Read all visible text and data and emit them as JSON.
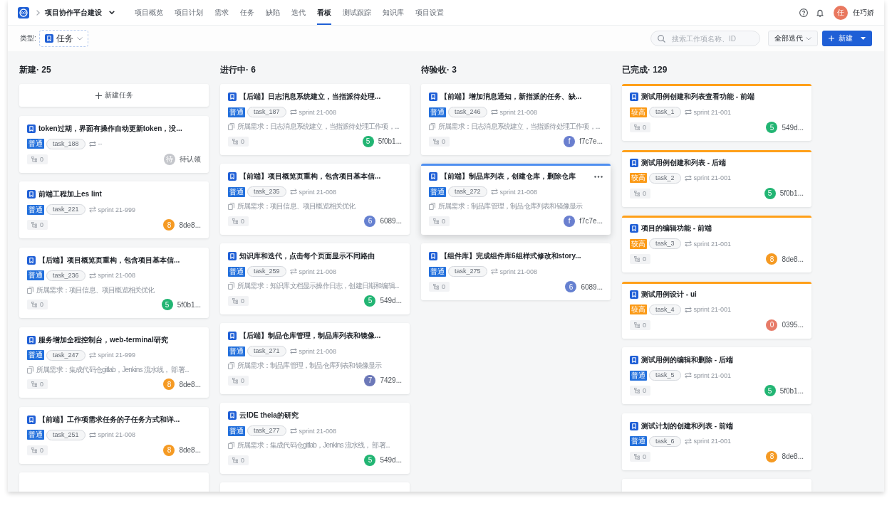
{
  "nav": {
    "project": "项目协作平台建设",
    "tabs": [
      {
        "label": "项目概览",
        "selected": false
      },
      {
        "label": "项目计划",
        "selected": false
      },
      {
        "label": "需求",
        "selected": false
      },
      {
        "label": "任务",
        "selected": false
      },
      {
        "label": "缺陷",
        "selected": false
      },
      {
        "label": "迭代",
        "selected": false
      },
      {
        "label": "看板",
        "selected": true
      },
      {
        "label": "测试跟踪",
        "selected": false
      },
      {
        "label": "知识库",
        "selected": false
      },
      {
        "label": "项目设置",
        "selected": false
      }
    ],
    "user": {
      "avatar": "任",
      "name": "任巧娇"
    }
  },
  "toolbar": {
    "type_label": "类型:",
    "type_select": "任务",
    "search": {
      "placeholder": "搜索工作项名称、ID"
    },
    "iteration_select": "全部迭代",
    "new_button": "新建"
  },
  "board": {
    "columns": [
      {
        "title": "新建· 25",
        "add_button": "新建任务",
        "more": true,
        "cards": [
          {
            "kind": "normal",
            "title": "token过期，界面有操作自动更新token，没...",
            "priority_label": "普通",
            "task_id": "task_188",
            "sprint": "--",
            "subtasks": "0",
            "assignee": {
              "avatar": "待",
              "name": "待认领",
              "color": "#c5c7cc"
            },
            "hovered": false
          },
          {
            "kind": "normal",
            "title": "前端工程加上es lint",
            "priority_label": "普通",
            "task_id": "task_221",
            "sprint": "sprint 21-999",
            "subtasks": "0",
            "assignee": {
              "avatar": "8",
              "name": "8de8...",
              "color": "#f59a23"
            },
            "hovered": false
          },
          {
            "kind": "normal",
            "title": "【后端】项目概览页重构，包含项目基本信...",
            "priority_label": "普通",
            "task_id": "task_236",
            "sprint": "sprint 21-008",
            "requirement": "所属需求：项目信息、项目概览相关优化",
            "subtasks": "0",
            "assignee": {
              "avatar": "5",
              "name": "5f0b1...",
              "color": "#22b573"
            },
            "hovered": false
          },
          {
            "kind": "normal",
            "title": "服务增加全程控制台，web-terminal研究",
            "priority_label": "普通",
            "task_id": "task_247",
            "sprint": "sprint 21-999",
            "requirement": "所属需求：集成代码仓gitlab，Jenkins 流水线， 部署...",
            "subtasks": "0",
            "assignee": {
              "avatar": "8",
              "name": "8de8...",
              "color": "#f59a23"
            },
            "hovered": false
          },
          {
            "kind": "normal",
            "title": "【前端】工作项需求任务的子任务方式和详...",
            "priority_label": "普通",
            "task_id": "task_251",
            "sprint": "sprint 21-008",
            "subtasks": "0",
            "assignee": {
              "avatar": "8",
              "name": "8de8...",
              "color": "#f59a23"
            },
            "hovered": false
          }
        ]
      },
      {
        "title": "进行中· 6",
        "more": true,
        "cards": [
          {
            "kind": "normal",
            "title": "【后端】日志消息系统建立，当指派待处理...",
            "priority_label": "普通",
            "task_id": "task_187",
            "sprint": "sprint 21-008",
            "requirement": "所属需求：日志消息系统建立，当指派待处理工作项，...",
            "subtasks": "0",
            "assignee": {
              "avatar": "5",
              "name": "5f0b1...",
              "color": "#22b573"
            },
            "hovered": false
          },
          {
            "kind": "normal",
            "title": "【前端】项目概览页重构，包含项目基本信...",
            "priority_label": "普通",
            "task_id": "task_235",
            "sprint": "sprint 21-008",
            "requirement": "所属需求：项目信息、项目概览相关优化",
            "subtasks": "0",
            "assignee": {
              "avatar": "6",
              "name": "6089...",
              "color": "#6580d0"
            },
            "hovered": false
          },
          {
            "kind": "normal",
            "title": "知识库和迭代，点击每个页面显示不同路由",
            "priority_label": "普通",
            "task_id": "task_259",
            "sprint": "sprint 21-008",
            "requirement": "所属需求：知识库文档显示操作日志，创建日期和编辑...",
            "subtasks": "0",
            "assignee": {
              "avatar": "5",
              "name": "549d...",
              "color": "#22b573"
            },
            "hovered": false
          },
          {
            "kind": "normal",
            "title": "【后端】制品仓库管理，制品库列表和镜像...",
            "priority_label": "普通",
            "task_id": "task_271",
            "sprint": "sprint 21-008",
            "requirement": "所属需求：制品库管理，制品仓库列表和镜像显示",
            "subtasks": "0",
            "assignee": {
              "avatar": "7",
              "name": "7429...",
              "color": "#6c78b8"
            },
            "hovered": false
          },
          {
            "kind": "normal",
            "title": "云IDE theia的研究",
            "priority_label": "普通",
            "task_id": "task_277",
            "sprint": "sprint 21-008",
            "requirement": "所属需求：集成代码仓gitlab，Jenkins 流水线， 部署...",
            "subtasks": "0",
            "assignee": {
              "avatar": "5",
              "name": "549d...",
              "color": "#22b573"
            },
            "hovered": false
          }
        ]
      },
      {
        "title": "待验收· 3",
        "more": false,
        "cards": [
          {
            "kind": "normal",
            "title": "【前端】增加消息通知，新指派的任务、缺...",
            "priority_label": "普通",
            "task_id": "task_246",
            "sprint": "sprint 21-008",
            "requirement": "所属需求：日志消息系统建立，当指派待处理工作项，...",
            "subtasks": "0",
            "assignee": {
              "avatar": "f",
              "name": "f7c7e...",
              "color": "#6a7fcf"
            },
            "hovered": false
          },
          {
            "kind": "normal",
            "title": "【前端】制品库列表，创建仓库，删除仓库",
            "priority_label": "普通",
            "task_id": "task_272",
            "sprint": "sprint 21-008",
            "requirement": "所属需求：制品库管理，制品仓库列表和镜像显示",
            "subtasks": "0",
            "assignee": {
              "avatar": "f",
              "name": "f7c7e...",
              "color": "#6a7fcf"
            },
            "hovered": true
          },
          {
            "kind": "normal",
            "title": "【组件库】完成组件库6组样式修改和story...",
            "priority_label": "普通",
            "task_id": "task_275",
            "sprint": "sprint 21-008",
            "subtasks": "0",
            "assignee": {
              "avatar": "6",
              "name": "6089...",
              "color": "#6580d0"
            },
            "hovered": false
          }
        ]
      },
      {
        "title": "已完成· 129",
        "more": true,
        "cards": [
          {
            "kind": "high",
            "title": "测试用例创建和列表查看功能 - 前端",
            "priority_label": "较高",
            "task_id": "task_1",
            "sprint": "sprint 21-001",
            "subtasks": "0",
            "assignee": {
              "avatar": "5",
              "name": "549d...",
              "color": "#22b573"
            },
            "hovered": false
          },
          {
            "kind": "high",
            "title": "测试用例创建和列表 - 后端",
            "priority_label": "较高",
            "task_id": "task_2",
            "sprint": "sprint 21-001",
            "subtasks": "0",
            "assignee": {
              "avatar": "5",
              "name": "5f0b1...",
              "color": "#22b573"
            },
            "hovered": false
          },
          {
            "kind": "high",
            "title": "项目的编辑功能 - 前端",
            "priority_label": "较高",
            "task_id": "task_3",
            "sprint": "sprint 21-001",
            "subtasks": "0",
            "assignee": {
              "avatar": "8",
              "name": "8de8...",
              "color": "#f59a23"
            },
            "hovered": false
          },
          {
            "kind": "high",
            "title": "测试用例设计 - ui",
            "priority_label": "较高",
            "task_id": "task_4",
            "sprint": "sprint 21-001",
            "subtasks": "0",
            "assignee": {
              "avatar": "0",
              "name": "0395...",
              "color": "#e77b68"
            },
            "hovered": false
          },
          {
            "kind": "normal",
            "title": "测试用例的编辑和删除 - 后端",
            "priority_label": "普通",
            "task_id": "task_5",
            "sprint": "sprint 21-001",
            "subtasks": "0",
            "assignee": {
              "avatar": "5",
              "name": "5f0b1...",
              "color": "#22b573"
            },
            "hovered": false
          },
          {
            "kind": "normal",
            "title": "测试计划的创建和列表 - 前端",
            "priority_label": "普通",
            "task_id": "task_6",
            "sprint": "sprint 21-001",
            "subtasks": "0",
            "assignee": {
              "avatar": "8",
              "name": "8de8...",
              "color": "#f59a23"
            },
            "hovered": false
          }
        ]
      }
    ]
  }
}
